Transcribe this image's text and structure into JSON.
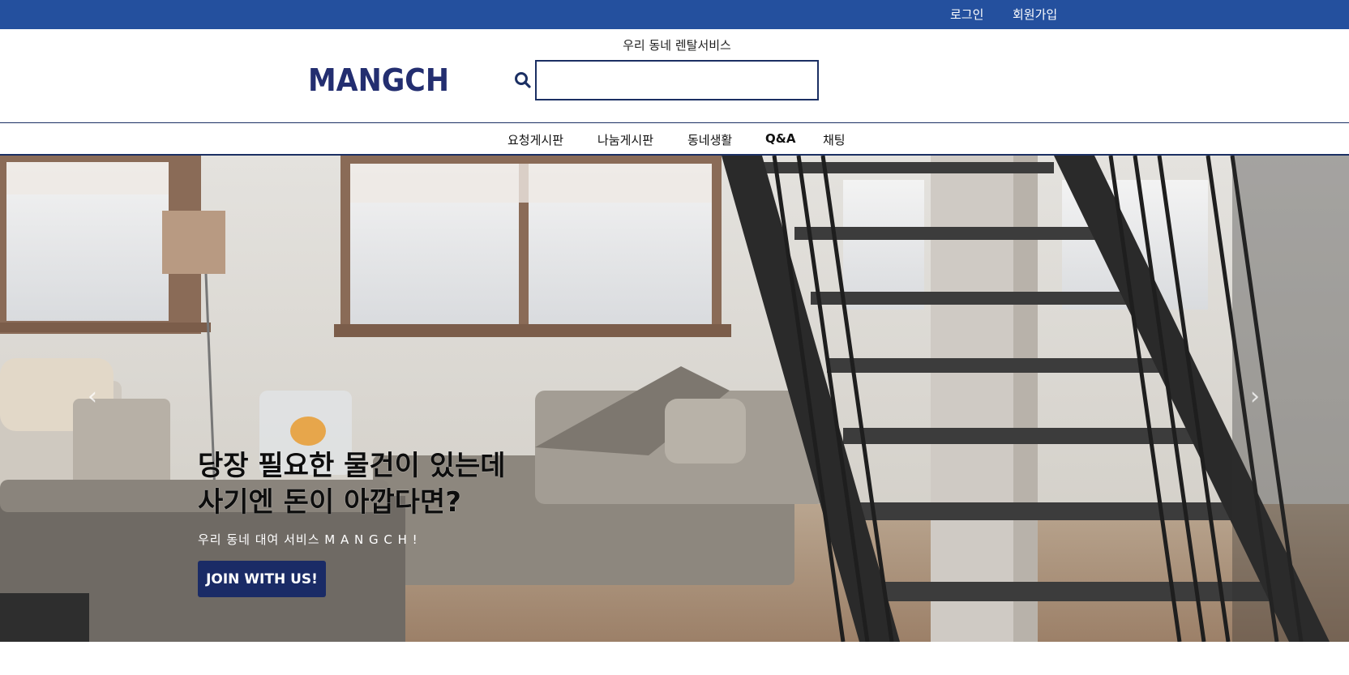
{
  "topbar": {
    "login": "로그인",
    "signup": "회원가입",
    "color": "#24509e"
  },
  "header": {
    "tagline": "우리 동네 렌탈서비스",
    "logo_text": "MANGCH",
    "logo_color": "#232e70"
  },
  "search": {
    "placeholder": "",
    "value": "",
    "icon": "search-icon"
  },
  "nav": {
    "items": [
      "요청게시판",
      "나눔게시판",
      "동네생활",
      "Q&A",
      "채팅"
    ]
  },
  "hero": {
    "title": "당장 필요한 물건이 있는데\n사기엔 돈이 아깝다면?",
    "subtitle": "우리 동네 대여 서비스 M A N G C H !",
    "button": "JOIN WITH US!",
    "prev_icon": "chevron-left-icon",
    "next_icon": "chevron-right-icon"
  }
}
